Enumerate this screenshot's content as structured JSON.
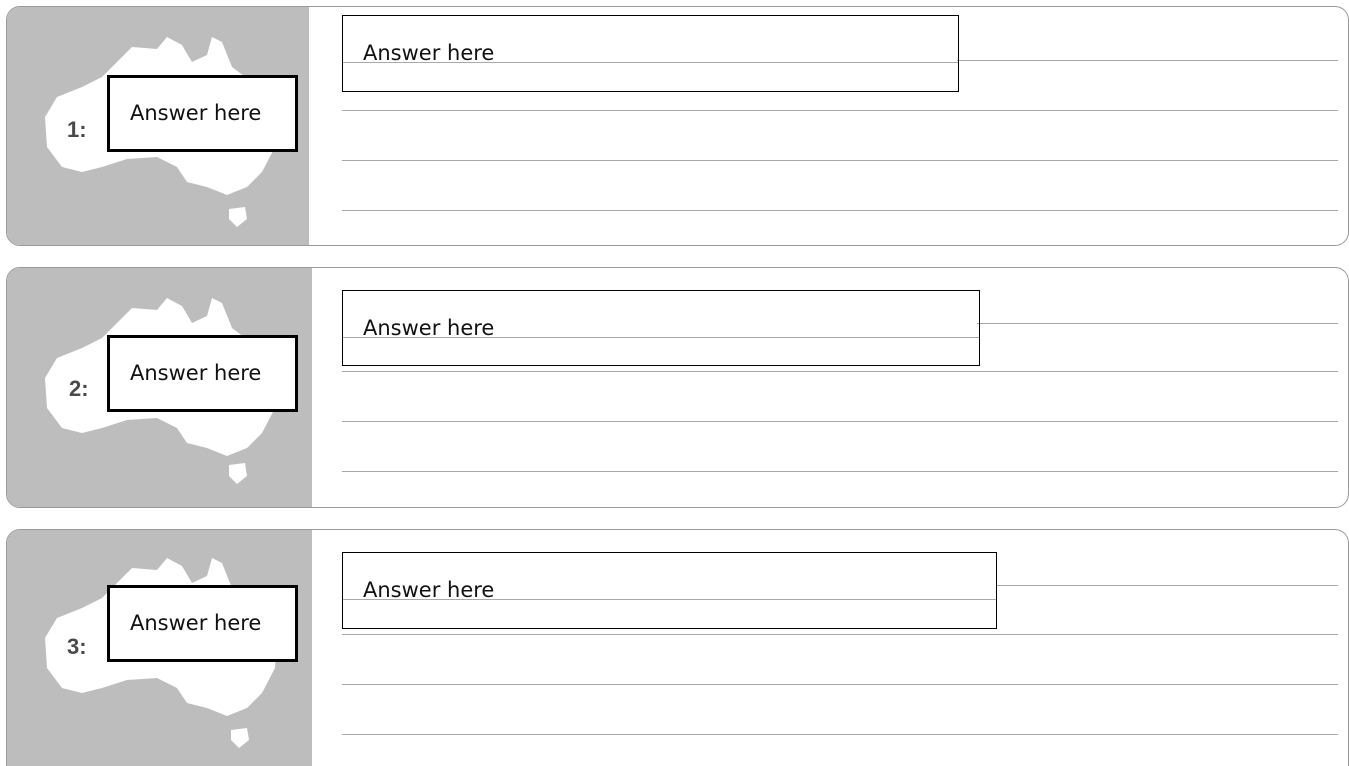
{
  "rows": [
    {
      "number": "1:",
      "map_answer": "Answer here",
      "text_answer": "Answer here",
      "map_icon": "australia-map-icon"
    },
    {
      "number": "2:",
      "map_answer": "Answer here",
      "text_answer": "Answer here",
      "map_icon": "australia-map-icon"
    },
    {
      "number": "3:",
      "map_answer": "Answer here",
      "text_answer": "Answer here",
      "map_icon": "australia-map-icon"
    }
  ],
  "colors": {
    "map_panel": "#bdbdbd",
    "map_land": "#ffffff",
    "rule_line": "#a9a9a9",
    "box_border": "#000000"
  }
}
